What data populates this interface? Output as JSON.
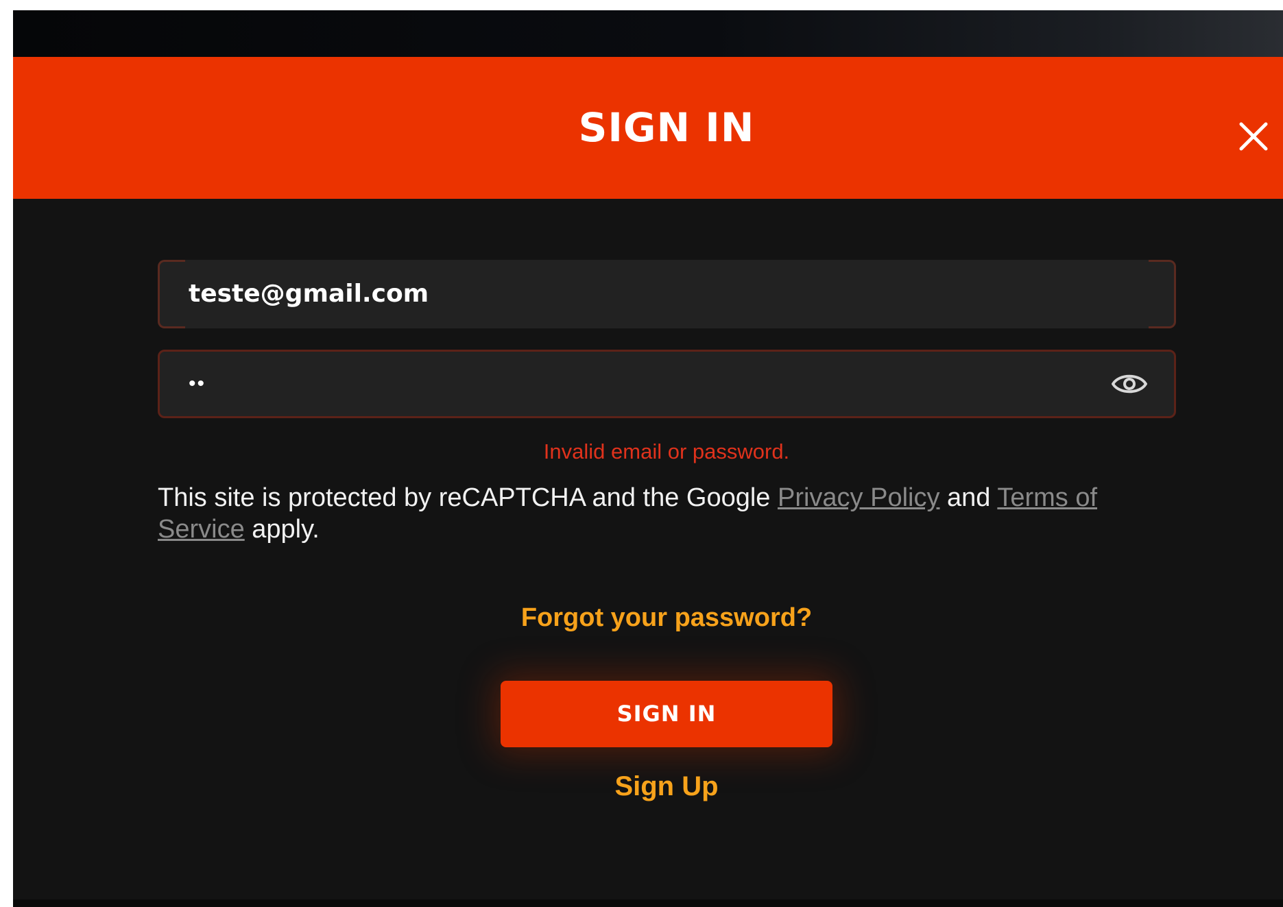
{
  "modal": {
    "title": "SIGN IN",
    "close_icon": "close-icon"
  },
  "form": {
    "email": {
      "value": "teste@gmail.com"
    },
    "password": {
      "masked_value": "••",
      "toggle_icon": "eye-icon"
    },
    "error": "Invalid email or password."
  },
  "recaptcha": {
    "prefix": "This site is protected by reCAPTCHA and the Google ",
    "privacy_link": "Privacy Policy",
    "middle": " and ",
    "terms_link": "Terms of Service",
    "suffix": " apply."
  },
  "actions": {
    "forgot_password": "Forgot your password?",
    "sign_in": "SIGN IN",
    "sign_up": "Sign Up"
  },
  "colors": {
    "accent": "#eb3300",
    "link_orange": "#f7a21b",
    "error_red": "#e0321c",
    "background": "#131313"
  }
}
